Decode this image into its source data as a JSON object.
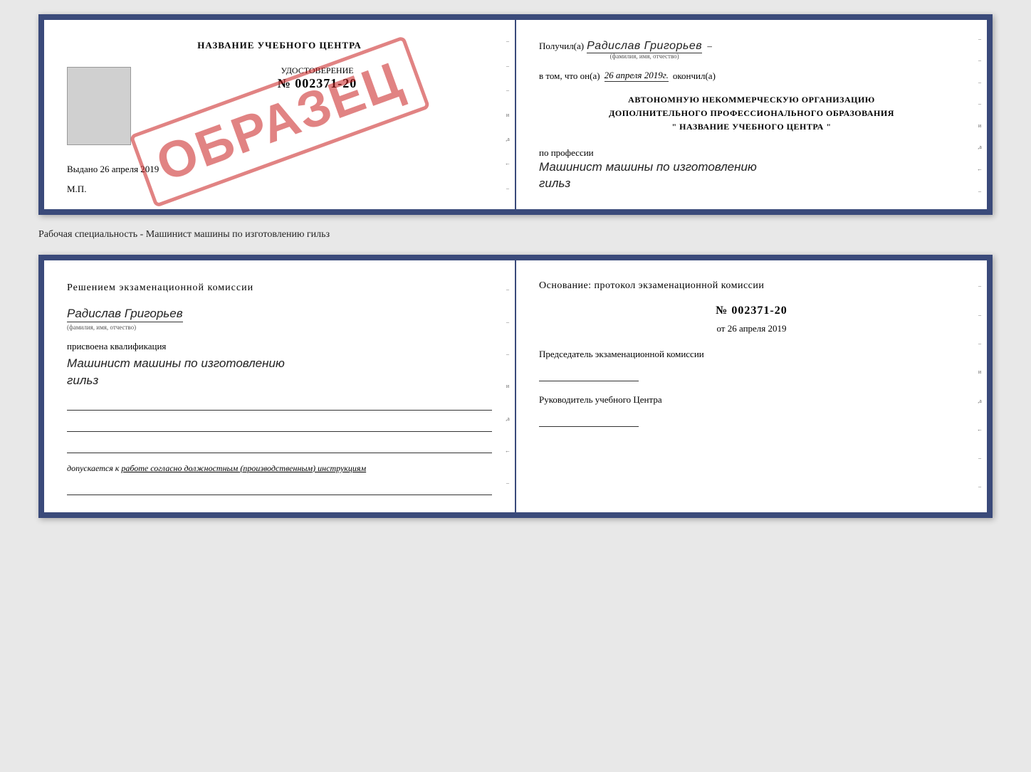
{
  "top_doc": {
    "left": {
      "title": "НАЗВАНИЕ УЧЕБНОГО ЦЕНТРА",
      "stamp": "ОБРАЗЕЦ",
      "cert_label": "УДОСТОВЕРЕНИЕ",
      "cert_number_prefix": "№",
      "cert_number": "002371-20",
      "issued_label": "Выдано",
      "issued_date": "26 апреля 2019",
      "mp_label": "М.П."
    },
    "right": {
      "received_prefix": "Получил(а)",
      "received_name": "Радислав Григорьев",
      "fio_label": "(фамилия, имя, отчество)",
      "date_prefix": "в том, что он(а)",
      "date_value": "26 апреля 2019г.",
      "finished_label": "окончил(а)",
      "org_line1": "АВТОНОМНУЮ НЕКОММЕРЧЕСКУЮ ОРГАНИЗАЦИЮ",
      "org_line2": "ДОПОЛНИТЕЛЬНОГО ПРОФЕССИОНАЛЬНОГО ОБРАЗОВАНИЯ",
      "org_quote_open": "\"",
      "org_name": "НАЗВАНИЕ УЧЕБНОГО ЦЕНТРА",
      "org_quote_close": "\"",
      "profession_label": "по профессии",
      "profession_value": "Машинист машины по изготовлению",
      "profession_value2": "гильз"
    }
  },
  "separator": {
    "text": "Рабочая специальность - Машинист машины по изготовлению гильз"
  },
  "bottom_doc": {
    "left": {
      "section_title": "Решением  экзаменационной  комиссии",
      "name": "Радислав Григорьев",
      "fio_label": "(фамилия, имя, отчество)",
      "assigned_label": "присвоена квалификация",
      "qualification_line1": "Машинист  машины  по  изготовлению",
      "qualification_line2": "гильз",
      "допуск_prefix": "допускается к",
      "допуск_text": "работе согласно должностным (производственным) инструкциям"
    },
    "right": {
      "osnov_title": "Основание: протокол экзаменационной  комиссии",
      "number_prefix": "№",
      "number_value": "002371-20",
      "date_prefix": "от",
      "date_value": "26 апреля 2019",
      "chairman_label": "Председатель экзаменационной комиссии",
      "director_label": "Руководитель учебного Центра"
    }
  }
}
